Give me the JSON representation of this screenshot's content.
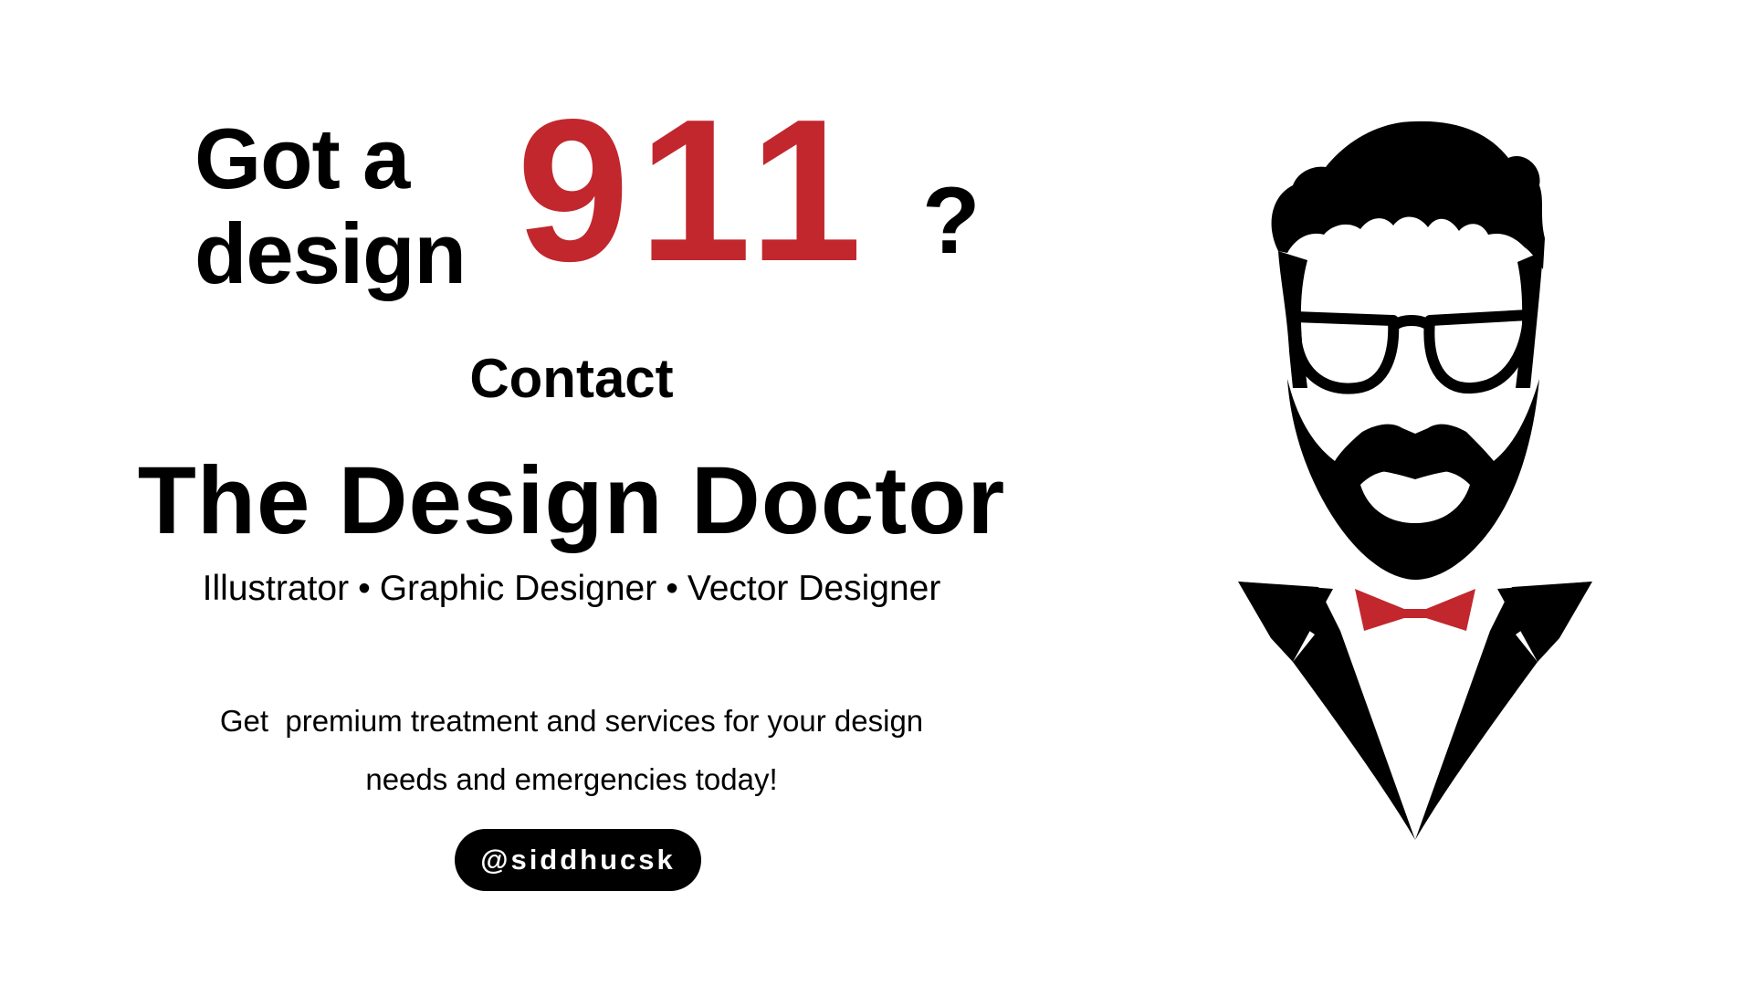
{
  "headline": {
    "line1": "Got a",
    "line2": "design",
    "number": "911",
    "question_mark": "?"
  },
  "contact": {
    "label": "Contact",
    "name": "The Design Doctor"
  },
  "roles": [
    "Illustrator",
    "Graphic Designer",
    "Vector Designer"
  ],
  "roles_separator": "•",
  "tagline": {
    "line1": "Get  premium treatment and services for your design",
    "line2": "needs and emergencies today!"
  },
  "handle": {
    "label": "@siddhucsk"
  },
  "illustration": {
    "figure": "bearded-man-with-glasses-and-bow-tie",
    "icons": [
      "hair-icon",
      "glasses-icon",
      "beard-icon",
      "bow-tie-icon",
      "tuxedo-lapel-icon"
    ]
  },
  "colors": {
    "background": "#ffffff",
    "text": "#000000",
    "accent_red": "#c1272d",
    "pill_background": "#000000",
    "pill_text": "#ffffff"
  }
}
